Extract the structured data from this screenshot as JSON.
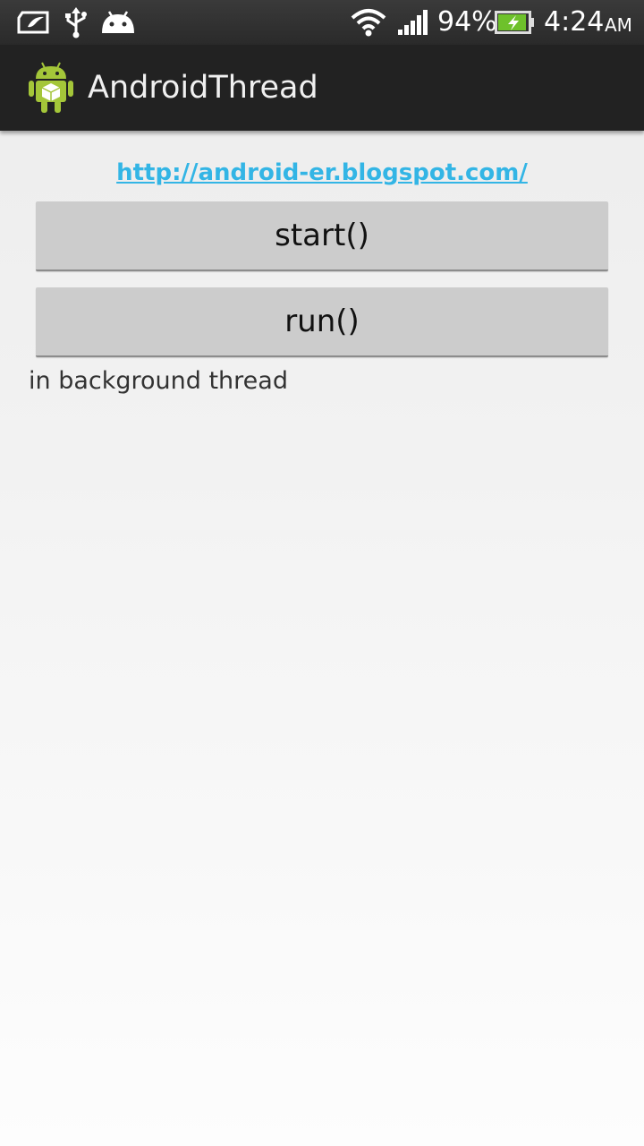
{
  "status_bar": {
    "battery_percent": "94%",
    "battery_level": 0.94,
    "time": "4:24",
    "ampm": "AM",
    "icons": [
      "evernote-icon",
      "usb-icon",
      "android-debug-icon",
      "wifi-icon",
      "signal-icon",
      "battery-charging-icon"
    ]
  },
  "action_bar": {
    "title": "AndroidThread",
    "icon": "android-app-icon"
  },
  "content": {
    "link_text": "http://android-er.blogspot.com/",
    "start_button_label": "start()",
    "run_button_label": "run()",
    "status_text": "in background thread"
  },
  "colors": {
    "link": "#33b5e5",
    "action_bar": "#222222",
    "button": "#cccccc",
    "battery_fill": "#6ec12b"
  }
}
